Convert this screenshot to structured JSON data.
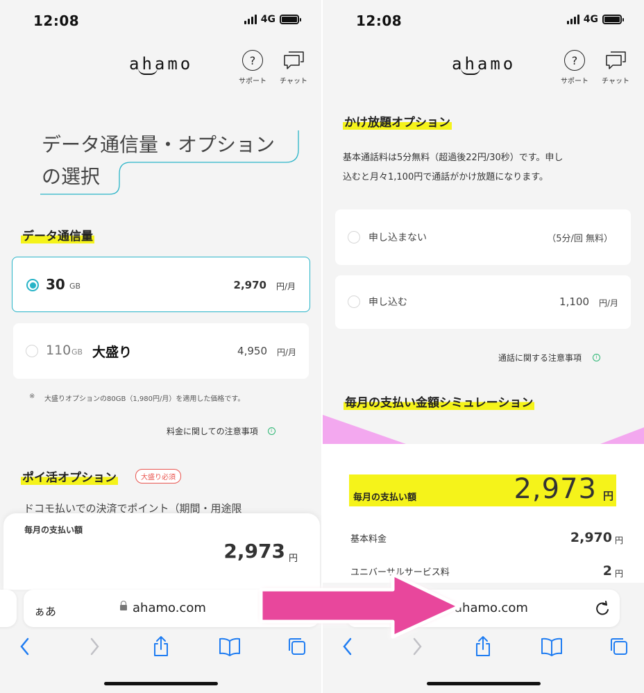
{
  "status": {
    "time": "12:08",
    "network": "4G"
  },
  "header": {
    "logo": "ahamo",
    "support_label": "サポート",
    "chat_label": "チャット"
  },
  "left": {
    "title_line1": "データ通信量・オプション",
    "title_line2": "の選択",
    "data_section_title": "データ通信量",
    "plans": [
      {
        "amount": "30",
        "unit": "GB",
        "extra": "",
        "price": "2,970",
        "price_unit": "円/月",
        "selected": true
      },
      {
        "amount": "110",
        "unit": "GB",
        "extra": "大盛り",
        "price": "4,950",
        "price_unit": "円/月",
        "selected": false
      }
    ],
    "plan_note_mark": "※",
    "plan_note": "大盛りオプションの80GB（1,980円/月）を適用した価格です。",
    "fee_notes_link": "料金に関しての注意事項",
    "poi_section_title": "ポイ活オプション",
    "poi_badge": "大盛り必須",
    "partial_text": "ドコモ払いでの決済でポイント（期間・用途限",
    "footer_label": "毎月の支払い額",
    "footer_amount": "2,973",
    "footer_unit": "円"
  },
  "right": {
    "kakehodai_title": "かけ放題オプション",
    "kakehodai_desc_line1": "基本通話料は5分無料（超過後22円/30秒）です。申し",
    "kakehodai_desc_line2": "込むと月々1,100円で通話がかけ放題になります。",
    "options": [
      {
        "label": "申し込まない",
        "price": "（5分/回 無料）",
        "price_unit": ""
      },
      {
        "label": "申し込む",
        "price": "1,100",
        "price_unit": "円/月"
      }
    ],
    "call_notes_link": "通話に関する注意事項",
    "simulation_title": "毎月の支払い金額シミュレーション",
    "total_label": "毎月の支払い額",
    "total_amount": "2,973",
    "total_unit": "円",
    "rows": [
      {
        "label": "基本料金",
        "amount": "2,970",
        "unit": "円"
      },
      {
        "label": "ユニバーサルサービス料",
        "amount": "2",
        "unit": "円"
      }
    ]
  },
  "browser": {
    "text_size_label": "ぁあ",
    "url": "ahamo.com"
  },
  "colors": {
    "accent_teal": "#27b3c7",
    "highlight_yellow": "#f5f31a",
    "arrow_pink": "#e8479c",
    "badge_red": "#e9554f",
    "ios_blue": "#1e7cf2"
  },
  "icons": [
    "signal-icon",
    "battery-icon",
    "question-icon",
    "chat-icon",
    "lock-icon",
    "reload-icon",
    "back-icon",
    "forward-icon",
    "share-icon",
    "bookmarks-icon",
    "tabs-icon",
    "info-icon",
    "arrow-icon"
  ]
}
